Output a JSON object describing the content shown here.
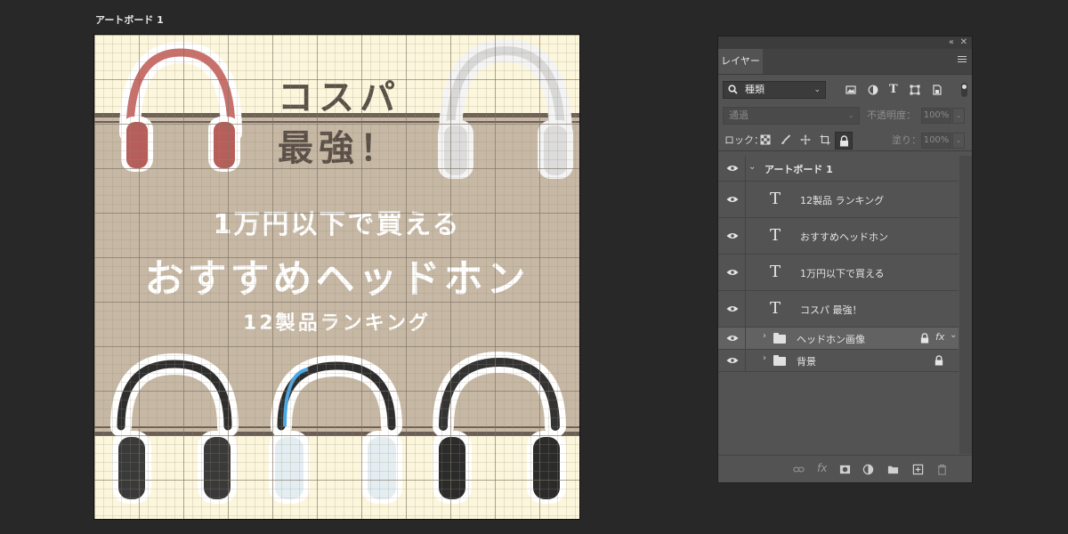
{
  "artboard": {
    "label": "アートボード 1",
    "headline_top_1": "コスパ",
    "headline_top_2": "最強！",
    "line1": "1万円以下で買える",
    "line2": "おすすめヘッドホン",
    "line3": "12製品ランキング",
    "colors": {
      "background_cream": "#fcf7dc",
      "band_beige": "#c6b8a4",
      "stripe": "#6b5f55",
      "title_dark": "#5a5048",
      "headline_white": "#ffffff"
    }
  },
  "panel": {
    "tab_label": "レイヤー",
    "filter_kind": "種類",
    "blend_mode": "通過",
    "opacity_label": "不透明度：",
    "opacity_value": "100%",
    "lock_label": "ロック：",
    "fill_label": "塗り：",
    "fill_value": "100%",
    "layers": [
      {
        "name": "アートボード 1",
        "type": "artboard",
        "expanded": true
      },
      {
        "name": "12製品 ランキング",
        "type": "text"
      },
      {
        "name": "おすすめヘッドホン",
        "type": "text"
      },
      {
        "name": "1万円以下で買える",
        "type": "text"
      },
      {
        "name": "コスパ 最強！",
        "type": "text"
      },
      {
        "name": "ヘッドホン画像",
        "type": "group",
        "locked": true,
        "fx": "fx",
        "selected": true
      },
      {
        "name": "背景",
        "type": "group",
        "locked": true
      }
    ],
    "icons": {
      "filter": [
        "image-filter-icon",
        "adjustment-filter-icon",
        "text-filter-icon",
        "shape-filter-icon",
        "smart-object-filter-icon"
      ],
      "lock": [
        "lock-transparent-icon",
        "lock-pixels-icon",
        "lock-position-icon",
        "lock-artboard-icon",
        "lock-all-icon"
      ],
      "bottom": [
        "link-layers-icon",
        "add-style-icon",
        "add-mask-icon",
        "new-adjustment-icon",
        "new-group-icon",
        "new-layer-icon",
        "delete-layer-icon"
      ]
    }
  }
}
